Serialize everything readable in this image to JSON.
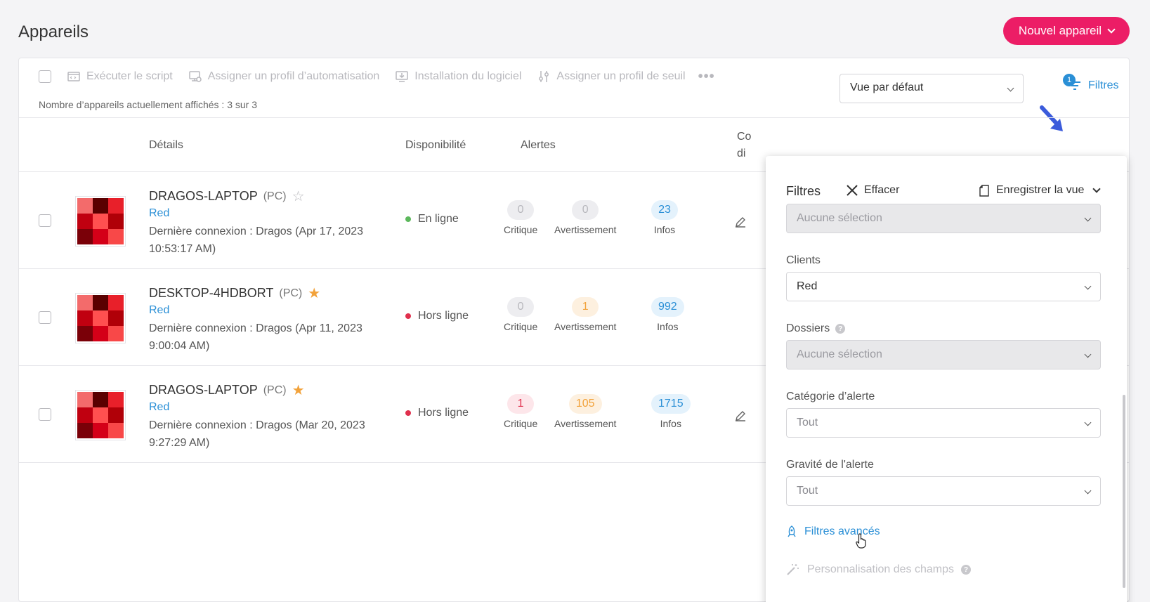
{
  "page": {
    "title": "Appareils",
    "new_device_label": "Nouvel appareil"
  },
  "toolbar": {
    "actions": [
      {
        "label": "Exécuter le script",
        "icon": "script-icon"
      },
      {
        "label": "Assigner un profil d’automatisation",
        "icon": "automation-profile-icon"
      },
      {
        "label": "Installation du logiciel",
        "icon": "download-install-icon"
      },
      {
        "label": "Assigner un profil de seuil",
        "icon": "sliders-icon"
      }
    ],
    "more_label": "•••",
    "count_text": "Nombre d’appareils actuellement affichés : 3 sur 3",
    "view_select": "Vue par défaut",
    "filters_label": "Filtres",
    "filters_badge": "1"
  },
  "table": {
    "headers": {
      "details": "Détails",
      "availability": "Disponibilité",
      "alerts": "Alertes",
      "partial1": "Co",
      "partial2": "di"
    },
    "rows": [
      {
        "name": "DRAGOS-LAPTOP",
        "type": "(PC)",
        "favorite": false,
        "star": "☆",
        "client": "Red",
        "last_connection": "Dernière connexion : Dragos (Apr 17, 2023 10:53:17 AM)",
        "status": "En ligne",
        "status_color": "#5cb85c",
        "critical": "0",
        "warning": "0",
        "info": "23",
        "critical_label": "Critique",
        "warning_label": "Avertissement",
        "info_label": "Infos"
      },
      {
        "name": "DESKTOP-4HDBORT",
        "type": "(PC)",
        "favorite": true,
        "star": "★",
        "client": "Red",
        "last_connection": "Dernière connexion : Dragos (Apr 11, 2023 9:00:04 AM)",
        "status": "Hors ligne",
        "status_color": "#e0304d",
        "critical": "0",
        "warning": "1",
        "info": "992",
        "critical_label": "Critique",
        "warning_label": "Avertissement",
        "info_label": "Infos"
      },
      {
        "name": "DRAGOS-LAPTOP",
        "type": "(PC)",
        "favorite": true,
        "star": "★",
        "client": "Red",
        "last_connection": "Dernière connexion : Dragos (Mar 20, 2023 9:27:29 AM)",
        "status": "Hors ligne",
        "status_color": "#e0304d",
        "critical": "1",
        "warning": "105",
        "info": "1715",
        "critical_label": "Critique",
        "warning_label": "Avertissement",
        "info_label": "Infos"
      }
    ]
  },
  "filters_panel": {
    "title": "Filtres",
    "clear_label": "Effacer",
    "save_view_label": "Enregistrer la vue",
    "top_select": "Aucune sélection",
    "clients_label": "Clients",
    "clients_value": "Red",
    "folders_label": "Dossiers",
    "folders_value": "Aucune sélection",
    "alert_category_label": "Catégorie d’alerte",
    "alert_category_value": "Tout",
    "alert_severity_label": "Gravité de l'alerte",
    "alert_severity_value": "Tout",
    "advanced_filters_label": "Filtres avancés",
    "field_customization_label": "Personnalisation des champs"
  },
  "colors": {
    "accent_pink": "#ec1d66",
    "link_blue": "#2a8fd6",
    "star_orange": "#f2a23a"
  }
}
